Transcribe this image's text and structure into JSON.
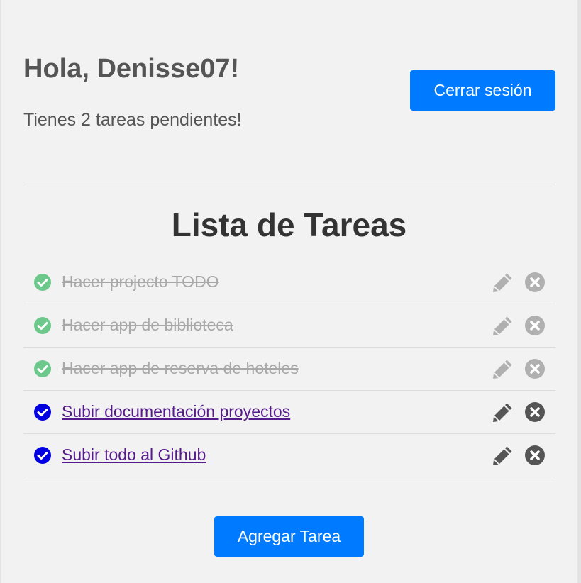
{
  "header": {
    "greeting": "Hola, Denisse07!",
    "pending_text": "Tienes 2 tareas pendientes!",
    "logout_label": "Cerrar sesión"
  },
  "list": {
    "title": "Lista de Tareas",
    "tasks": [
      {
        "label": "Hacer projecto TODO",
        "completed": true
      },
      {
        "label": "Hacer app de biblioteca",
        "completed": true
      },
      {
        "label": "Hacer app de reserva de hoteles",
        "completed": true
      },
      {
        "label": "Subir documentación proyectos",
        "completed": false
      },
      {
        "label": "Subir todo al Github",
        "completed": false
      }
    ]
  },
  "footer": {
    "add_label": "Agregar Tarea"
  },
  "icons": {
    "check": "check-circle-icon",
    "edit": "pencil-icon",
    "delete": "close-circle-icon"
  },
  "colors": {
    "primary_button": "#007bff",
    "done_check": "#6cc98b",
    "todo_check": "#0000e0",
    "done_text": "#a8a8a8",
    "todo_link": "#551a8b",
    "icon_active": "#555555",
    "icon_inactive": "#b0b0b0"
  }
}
